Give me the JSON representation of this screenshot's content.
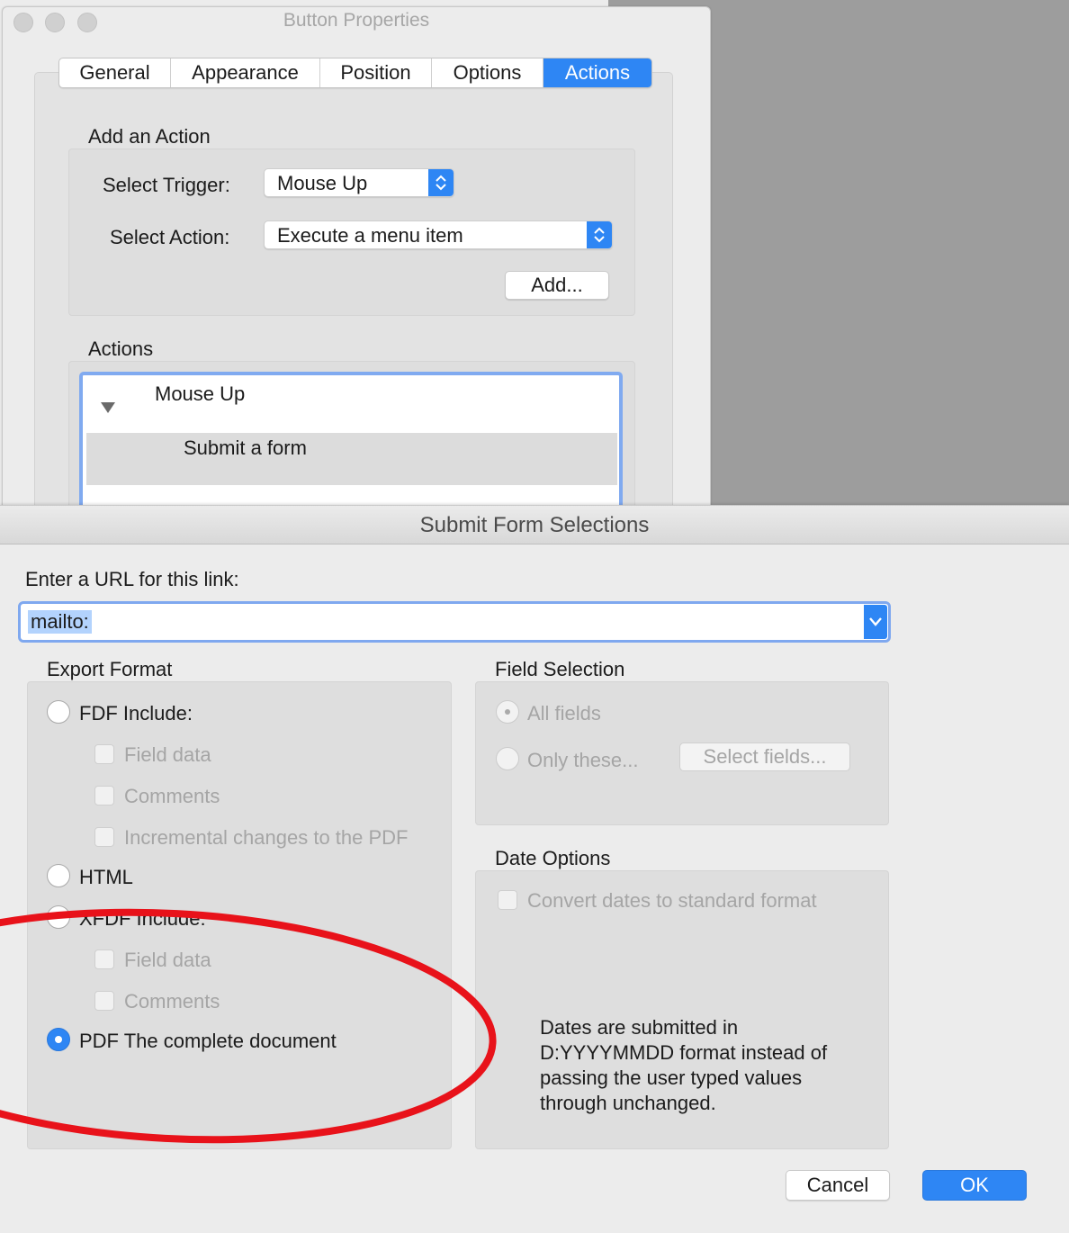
{
  "button_properties": {
    "title": "Button Properties",
    "tabs": [
      {
        "label": "General"
      },
      {
        "label": "Appearance"
      },
      {
        "label": "Position"
      },
      {
        "label": "Options"
      },
      {
        "label": "Actions",
        "active": true
      }
    ],
    "add_action": {
      "heading": "Add an Action",
      "trigger_label": "Select Trigger:",
      "trigger_value": "Mouse Up",
      "action_label": "Select Action:",
      "action_value": "Execute a menu item",
      "add_button": "Add..."
    },
    "actions": {
      "heading": "Actions",
      "tree": [
        {
          "label": "Mouse Up",
          "children": [
            {
              "label": "Submit a form"
            }
          ]
        }
      ]
    }
  },
  "submit_form": {
    "title": "Submit Form Selections",
    "url_label": "Enter a URL for this link:",
    "url_value": "mailto:",
    "export_format": {
      "heading": "Export Format",
      "fdf_label": "FDF  Include:",
      "fdf_field_data": "Field data",
      "fdf_comments": "Comments",
      "fdf_incremental": "Incremental changes to the PDF",
      "html_label": "HTML",
      "xfdf_label": "XFDF  Include:",
      "xfdf_field_data": "Field data",
      "xfdf_comments": "Comments",
      "pdf_label": "PDF  The complete document",
      "selected": "PDF"
    },
    "field_selection": {
      "heading": "Field Selection",
      "all_fields": "All fields",
      "only_these": "Only these...",
      "select_fields_button": "Select fields..."
    },
    "date_options": {
      "heading": "Date Options",
      "convert_label": "Convert dates to standard format",
      "note_lines": [
        "Dates are submitted in",
        "D:YYYYMMDD format instead of",
        "passing the user typed values",
        "through unchanged."
      ]
    },
    "cancel_button": "Cancel",
    "ok_button": "OK"
  },
  "colors": {
    "accent": "#2e86f4",
    "annotation": "#e8121a"
  }
}
